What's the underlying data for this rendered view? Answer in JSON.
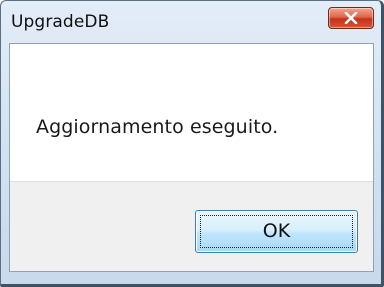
{
  "window": {
    "title": "UpgradeDB",
    "close_icon": "close-icon"
  },
  "dialog": {
    "message": "Aggiornamento eseguito.",
    "ok_label": "OK"
  },
  "colors": {
    "close_button": "#d6543a",
    "ok_button_border": "#3c7fb1",
    "frame": "#c8d9ec"
  }
}
